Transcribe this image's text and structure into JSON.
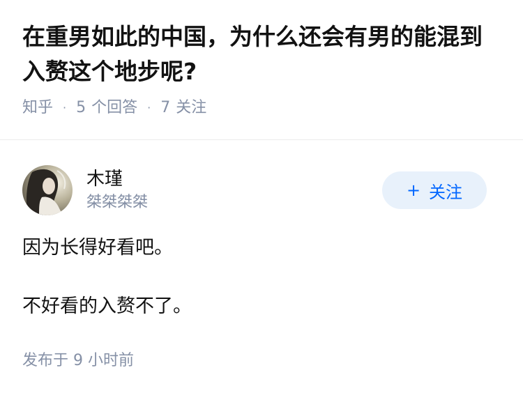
{
  "question": {
    "title": "在重男如此的中国，为什么还会有男的能混到入赘这个地步呢?",
    "source": "知乎",
    "answer_count": "5",
    "answer_label": "个回答",
    "follower_count": "7",
    "follower_label": "关注"
  },
  "answer": {
    "author_name": "木瑾",
    "author_bio": "桀桀桀桀",
    "follow_label": "关注",
    "follow_symbol": "+",
    "paragraphs": [
      "因为长得好看吧。",
      "不好看的入赘不了。"
    ],
    "published_prefix": "发布于",
    "published_time": "9 小时前"
  }
}
